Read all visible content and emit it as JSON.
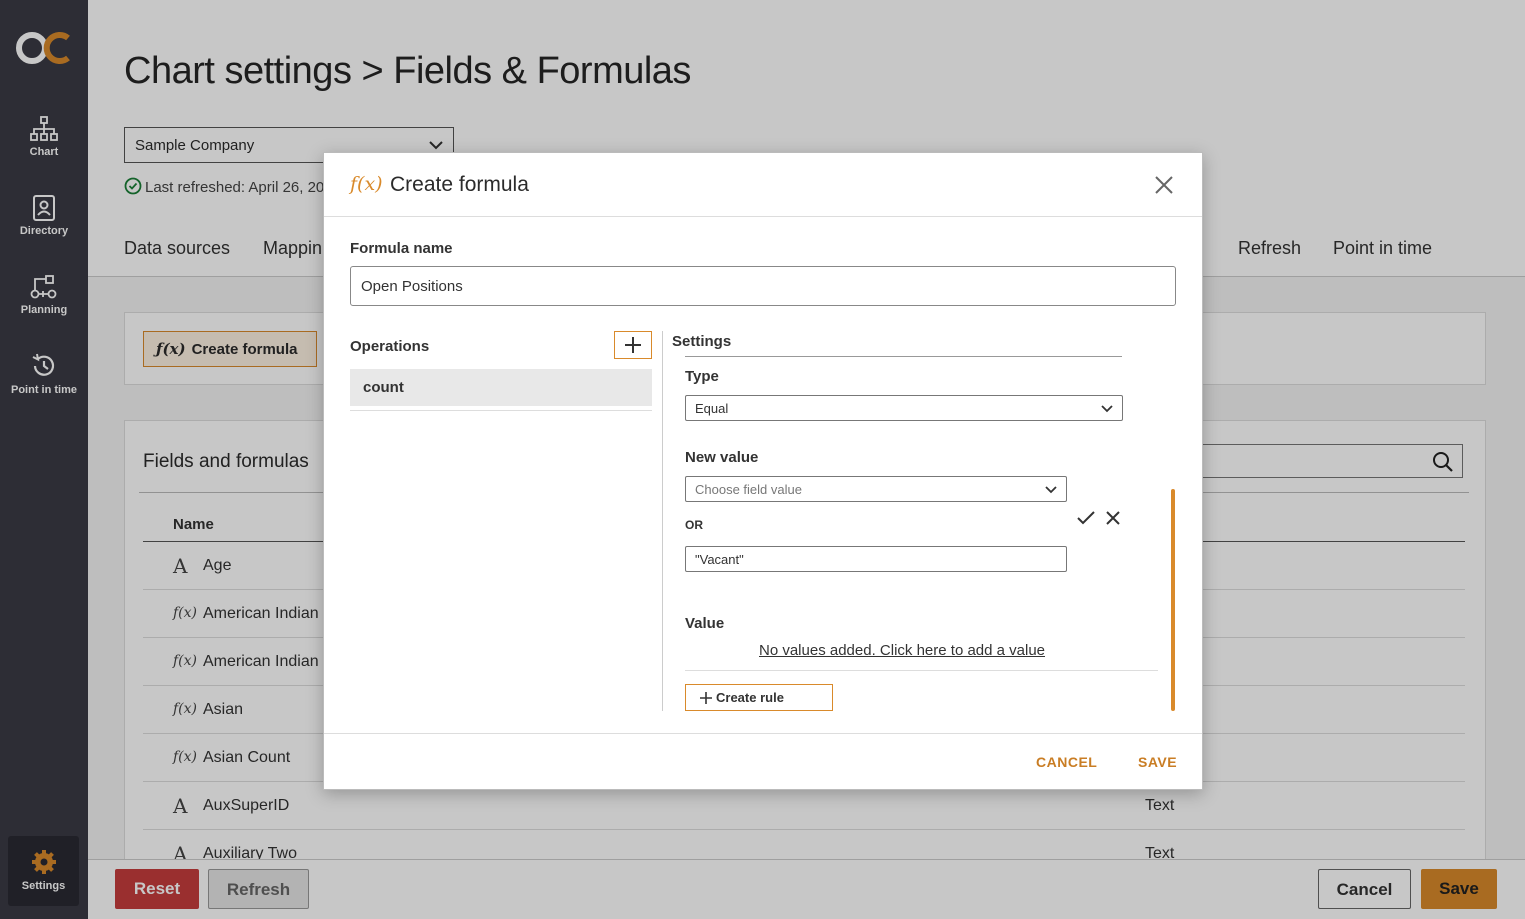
{
  "sidebar": {
    "logo": "OC",
    "items": [
      {
        "label": "Chart",
        "icon": "org-chart-icon"
      },
      {
        "label": "Directory",
        "icon": "directory-icon"
      },
      {
        "label": "Planning",
        "icon": "planning-icon"
      },
      {
        "label": "Point in time",
        "icon": "history-icon"
      }
    ],
    "settings": {
      "label": "Settings",
      "icon": "gear-icon"
    }
  },
  "page": {
    "title": "Chart settings > Fields & Formulas",
    "company": "Sample Company",
    "last_refreshed": "Last refreshed: April 26, 20",
    "tabs": [
      "Data sources",
      "Mappin",
      "Refresh",
      "Point in time"
    ],
    "create_formula_label": "Create formula",
    "fields_title": "Fields and formulas",
    "column_name": "Name",
    "fields": [
      {
        "icon": "A",
        "name": "Age",
        "type": ""
      },
      {
        "icon": "f(x)",
        "name": "American Indian c",
        "type": ""
      },
      {
        "icon": "f(x)",
        "name": "American Indian c",
        "type": ""
      },
      {
        "icon": "f(x)",
        "name": "Asian",
        "type": ""
      },
      {
        "icon": "f(x)",
        "name": "Asian Count",
        "type": ""
      },
      {
        "icon": "A",
        "name": "AuxSuperID",
        "type": "Text"
      },
      {
        "icon": "A",
        "name": "Auxiliary Two",
        "type": "Text"
      }
    ]
  },
  "bottom_bar": {
    "reset": "Reset",
    "refresh": "Refresh",
    "cancel": "Cancel",
    "save": "Save"
  },
  "modal": {
    "icon": "f(x)",
    "title": "Create formula",
    "formula_name_label": "Formula name",
    "formula_name_value": "Open Positions",
    "operations_label": "Operations",
    "operations": [
      "count"
    ],
    "settings_label": "Settings",
    "type_label": "Type",
    "type_value": "Equal",
    "new_value_label": "New value",
    "field_value_placeholder": "Choose field value",
    "or_label": "OR",
    "literal_value": "\"Vacant\"",
    "value_label": "Value",
    "no_values_text": "No values added. Click here to add a value",
    "create_rule_label": "Create rule",
    "cancel_label": "CANCEL",
    "save_label": "SAVE"
  },
  "colors": {
    "accent": "#d98a2b",
    "sidebar": "#3a3a44",
    "danger": "#c63d3d"
  }
}
